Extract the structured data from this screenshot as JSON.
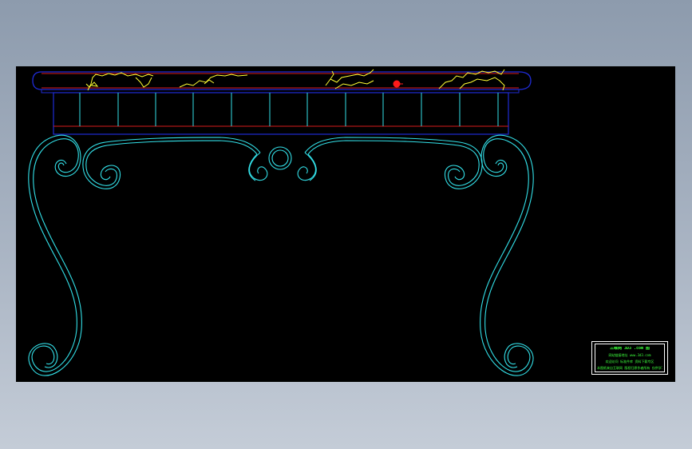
{
  "drawing": {
    "background": "#000000",
    "colors": {
      "outline_cyan": "#33e0e8",
      "tabletop_blue": "#1f2bd6",
      "edge_red": "#d81c1c",
      "marble_vein_yellow": "#ffff33",
      "marker_red": "#ff1a1a",
      "title_text_green": "#3cff3c",
      "title_frame_white": "#ffffff"
    },
    "components": [
      "tabletop-slab",
      "apron-with-vertical-slats",
      "scroll-legs",
      "center-scroll-ornament",
      "marble-veining",
      "title-block"
    ]
  },
  "title_block": {
    "line1": "三维网 ЗD3 .com 图",
    "line2": "网站链接地址  www.3d3.com",
    "line3": "欢迎访问 标准件库 资料下载专区",
    "line4": "本图纸来自互联网 版权归原作者所有 仅供学习"
  }
}
